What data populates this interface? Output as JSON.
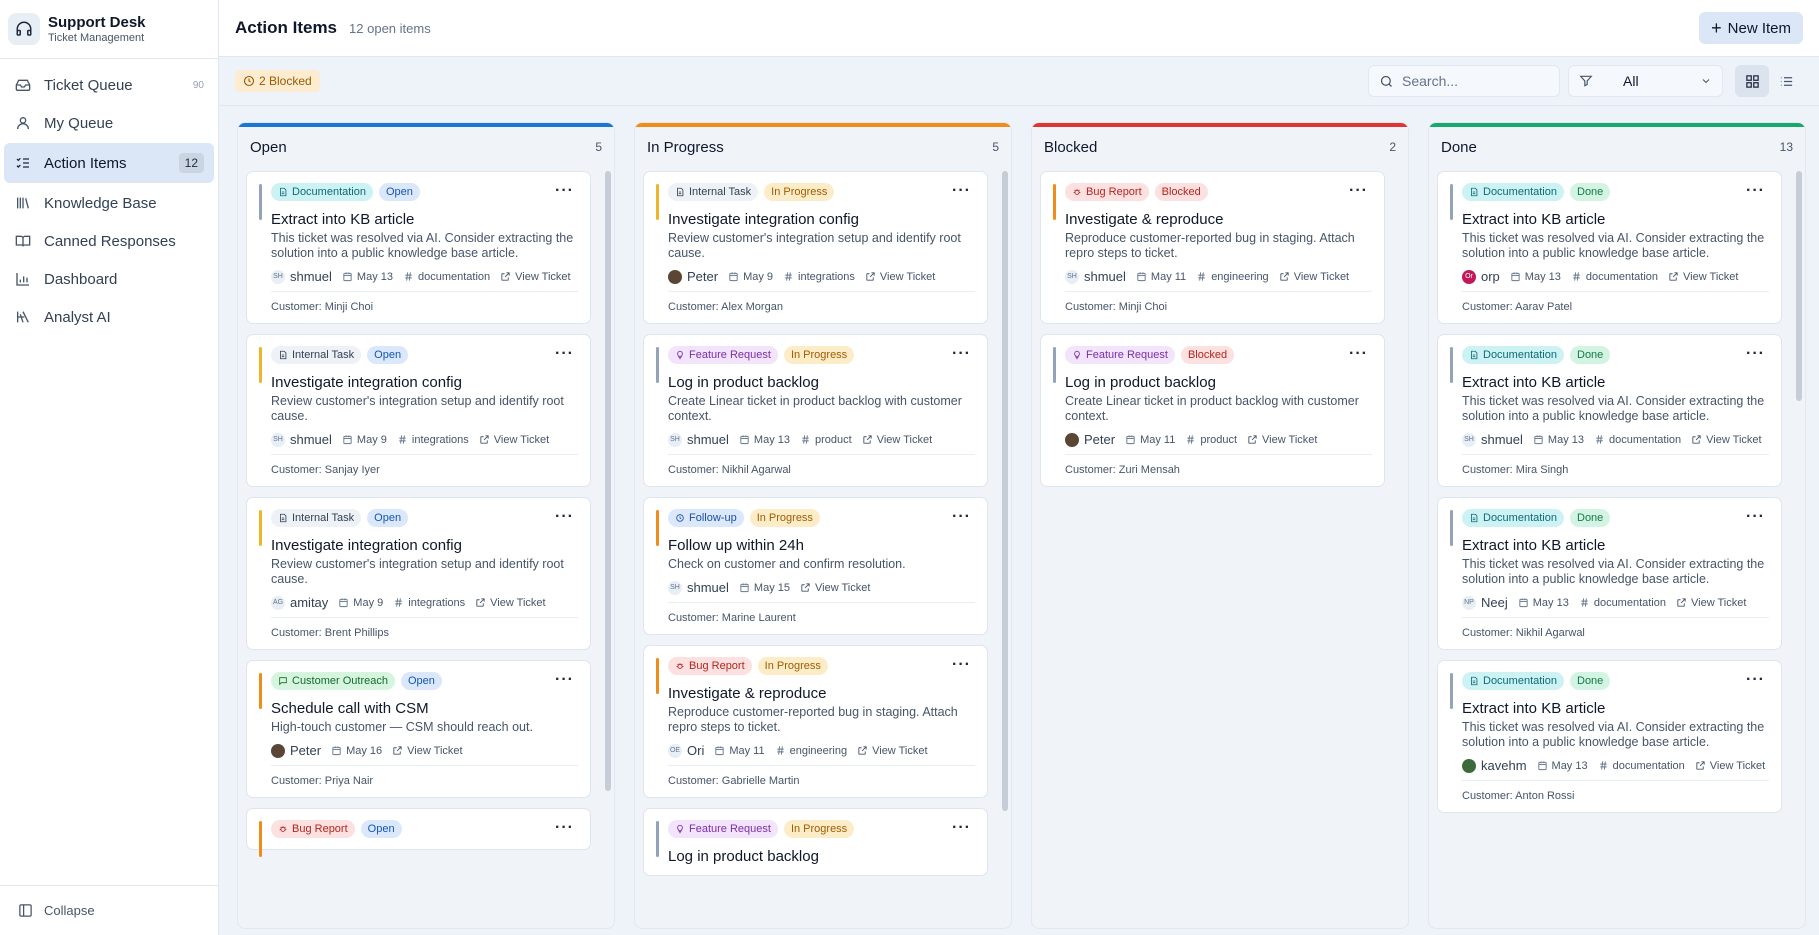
{
  "app": {
    "name": "Support Desk",
    "subtitle": "Ticket Management"
  },
  "nav": [
    {
      "label": "Ticket Queue",
      "icon": "inbox-icon",
      "count": "90",
      "active": false
    },
    {
      "label": "My Queue",
      "icon": "user-icon",
      "count": "",
      "active": false
    },
    {
      "label": "Action Items",
      "icon": "list-checks-icon",
      "count": "12",
      "active": true
    },
    {
      "label": "Knowledge Base",
      "icon": "library-icon",
      "count": "",
      "active": false
    },
    {
      "label": "Canned Responses",
      "icon": "book-icon",
      "count": "",
      "active": false
    },
    {
      "label": "Dashboard",
      "icon": "bar-chart-icon",
      "count": "",
      "active": false
    },
    {
      "label": "Analyst AI",
      "icon": "brain-icon",
      "count": "",
      "active": false
    }
  ],
  "collapse_label": "Collapse",
  "header": {
    "title": "Action Items",
    "subtitle": "12 open items",
    "new_button": "New Item"
  },
  "toolbar": {
    "blocked": "2 Blocked",
    "search_placeholder": "Search...",
    "filter_value": "All"
  },
  "colors": {
    "accent": "#1976d2",
    "open": "#1976d2",
    "in_progress": "#f08c1a",
    "blocked": "#e03535",
    "done": "#17a86b"
  },
  "columns": [
    {
      "title": "Open",
      "count": "5",
      "color": "#1976d2",
      "cards": [
        {
          "type": "Documentation",
          "type_key": "doc",
          "status": "Open",
          "status_key": "open",
          "title": "Extract into KB article",
          "desc": "This ticket was resolved via AI. Consider extracting the solution into a public knowledge base article.",
          "assignee": "shmuel",
          "initials": "SH",
          "date": "May 13",
          "tag": "#documentation",
          "link": "View Ticket",
          "customer": "Customer: Minji Choi"
        },
        {
          "type": "Internal Task",
          "type_key": "internal",
          "status": "Open",
          "status_key": "open",
          "title": "Investigate integration config",
          "desc": "Review customer's integration setup and identify root cause.",
          "assignee": "shmuel",
          "initials": "SH",
          "date": "May 9",
          "tag": "#integrations",
          "link": "View Ticket",
          "customer": "Customer: Sanjay Iyer"
        },
        {
          "type": "Internal Task",
          "type_key": "internal",
          "status": "Open",
          "status_key": "open",
          "title": "Investigate integration config",
          "desc": "Review customer's integration setup and identify root cause.",
          "assignee": "amitay",
          "initials": "AG",
          "date": "May 9",
          "tag": "#integrations",
          "link": "View Ticket",
          "customer": "Customer: Brent Phillips"
        },
        {
          "type": "Customer Outreach",
          "type_key": "outreach",
          "status": "Open",
          "status_key": "open",
          "title": "Schedule call with CSM",
          "desc": "High-touch customer — CSM should reach out.",
          "assignee": "Peter",
          "initials": "",
          "date": "May 16",
          "tag": "",
          "link": "View Ticket",
          "customer": "Customer: Priya Nair"
        },
        {
          "type": "Bug Report",
          "type_key": "bug",
          "status": "Open",
          "status_key": "open",
          "title": "",
          "desc": "",
          "assignee": "",
          "initials": "",
          "date": "",
          "tag": "",
          "link": "",
          "customer": ""
        }
      ]
    },
    {
      "title": "In Progress",
      "count": "5",
      "color": "#f08c1a",
      "cards": [
        {
          "type": "Internal Task",
          "type_key": "internal",
          "status": "In Progress",
          "status_key": "progress",
          "title": "Investigate integration config",
          "desc": "Review customer's integration setup and identify root cause.",
          "assignee": "Peter",
          "initials": "",
          "date": "May 9",
          "tag": "#integrations",
          "link": "View Ticket",
          "customer": "Customer: Alex Morgan"
        },
        {
          "type": "Feature Request",
          "type_key": "feature",
          "status": "In Progress",
          "status_key": "progress",
          "title": "Log in product backlog",
          "desc": "Create Linear ticket in product backlog with customer context.",
          "assignee": "shmuel",
          "initials": "SH",
          "date": "May 13",
          "tag": "#product",
          "link": "View Ticket",
          "customer": "Customer: Nikhil Agarwal"
        },
        {
          "type": "Follow-up",
          "type_key": "followup",
          "status": "In Progress",
          "status_key": "progress",
          "title": "Follow up within 24h",
          "desc": "Check on customer and confirm resolution.",
          "assignee": "shmuel",
          "initials": "SH",
          "date": "May 15",
          "tag": "",
          "link": "View Ticket",
          "customer": "Customer: Marine Laurent"
        },
        {
          "type": "Bug Report",
          "type_key": "bug",
          "status": "In Progress",
          "status_key": "progress",
          "title": "Investigate & reproduce",
          "desc": "Reproduce customer-reported bug in staging. Attach repro steps to ticket.",
          "assignee": "Ori",
          "initials": "OE",
          "date": "May 11",
          "tag": "#engineering",
          "link": "View Ticket",
          "customer": "Customer: Gabrielle Martin"
        },
        {
          "type": "Feature Request",
          "type_key": "feature",
          "status": "In Progress",
          "status_key": "progress",
          "title": "Log in product backlog",
          "desc": "",
          "assignee": "",
          "initials": "",
          "date": "",
          "tag": "",
          "link": "",
          "customer": ""
        }
      ]
    },
    {
      "title": "Blocked",
      "count": "2",
      "color": "#e03535",
      "cards": [
        {
          "type": "Bug Report",
          "type_key": "bug",
          "status": "Blocked",
          "status_key": "blocked",
          "title": "Investigate & reproduce",
          "desc": "Reproduce customer-reported bug in staging. Attach repro steps to ticket.",
          "assignee": "shmuel",
          "initials": "SH",
          "date": "May 11",
          "tag": "#engineering",
          "link": "View Ticket",
          "customer": "Customer: Minji Choi"
        },
        {
          "type": "Feature Request",
          "type_key": "feature",
          "status": "Blocked",
          "status_key": "blocked",
          "title": "Log in product backlog",
          "desc": "Create Linear ticket in product backlog with customer context.",
          "assignee": "Peter",
          "initials": "",
          "date": "May 11",
          "tag": "#product",
          "link": "View Ticket",
          "customer": "Customer: Zuri Mensah"
        }
      ]
    },
    {
      "title": "Done",
      "count": "13",
      "color": "#17a86b",
      "cards": [
        {
          "type": "Documentation",
          "type_key": "doc",
          "status": "Done",
          "status_key": "done",
          "title": "Extract into KB article",
          "desc": "This ticket was resolved via AI. Consider extracting the solution into a public knowledge base article.",
          "assignee": "orp",
          "initials": "Or",
          "date": "May 13",
          "tag": "#documentation",
          "link": "View Ticket",
          "customer": "Customer: Aarav Patel"
        },
        {
          "type": "Documentation",
          "type_key": "doc",
          "status": "Done",
          "status_key": "done",
          "title": "Extract into KB article",
          "desc": "This ticket was resolved via AI. Consider extracting the solution into a public knowledge base article.",
          "assignee": "shmuel",
          "initials": "SH",
          "date": "May 13",
          "tag": "#documentation",
          "link": "View Ticket",
          "customer": "Customer: Mira Singh"
        },
        {
          "type": "Documentation",
          "type_key": "doc",
          "status": "Done",
          "status_key": "done",
          "title": "Extract into KB article",
          "desc": "This ticket was resolved via AI. Consider extracting the solution into a public knowledge base article.",
          "assignee": "Neej",
          "initials": "NP",
          "date": "May 13",
          "tag": "#documentation",
          "link": "View Ticket",
          "customer": "Customer: Nikhil Agarwal"
        },
        {
          "type": "Documentation",
          "type_key": "doc",
          "status": "Done",
          "status_key": "done",
          "title": "Extract into KB article",
          "desc": "This ticket was resolved via AI. Consider extracting the solution into a public knowledge base article.",
          "assignee": "kavehm",
          "initials": "",
          "date": "May 13",
          "tag": "#documentation",
          "link": "View Ticket",
          "customer": "Customer: Anton Rossi"
        }
      ]
    }
  ]
}
